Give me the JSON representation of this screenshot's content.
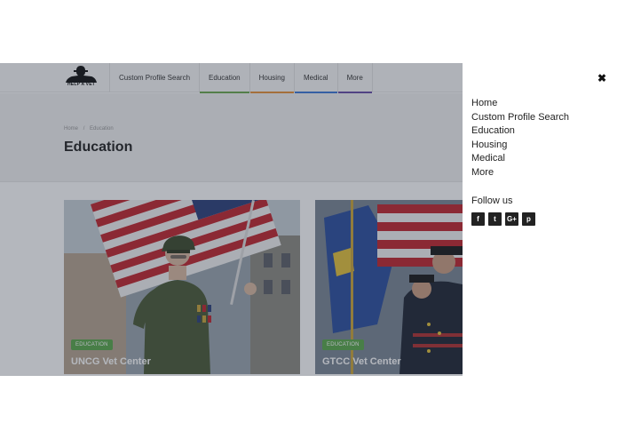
{
  "site": {
    "logo_text": "HELP A VET",
    "nav": [
      {
        "label": "Custom Profile Search",
        "accent": ""
      },
      {
        "label": "Education",
        "accent": "#6aa84f"
      },
      {
        "label": "Housing",
        "accent": "#e69138"
      },
      {
        "label": "Medical",
        "accent": "#3c78d8"
      },
      {
        "label": "More",
        "accent": "#674ea7"
      }
    ],
    "breadcrumb": {
      "home": "Home",
      "sep": "/",
      "current": "Education"
    },
    "page_title": "Education",
    "cards": [
      {
        "badge": "EDUCATION",
        "title": "UNCG Vet Center"
      },
      {
        "badge": "EDUCATION",
        "title": "GTCC Vet Center"
      }
    ]
  },
  "panel": {
    "close_glyph": "✖",
    "menu": [
      "Home",
      "Custom Profile Search",
      "Education",
      "Housing",
      "Medical",
      "More"
    ],
    "follow_label": "Follow us",
    "social": [
      {
        "icon": "facebook-icon",
        "glyph": "f"
      },
      {
        "icon": "twitter-icon",
        "glyph": "t"
      },
      {
        "icon": "google-plus-icon",
        "glyph": "G+"
      },
      {
        "icon": "pinterest-icon",
        "glyph": "p"
      }
    ]
  },
  "colors": {
    "overlay": "rgba(40,48,66,0.35)",
    "badge": "#5aa84a"
  }
}
